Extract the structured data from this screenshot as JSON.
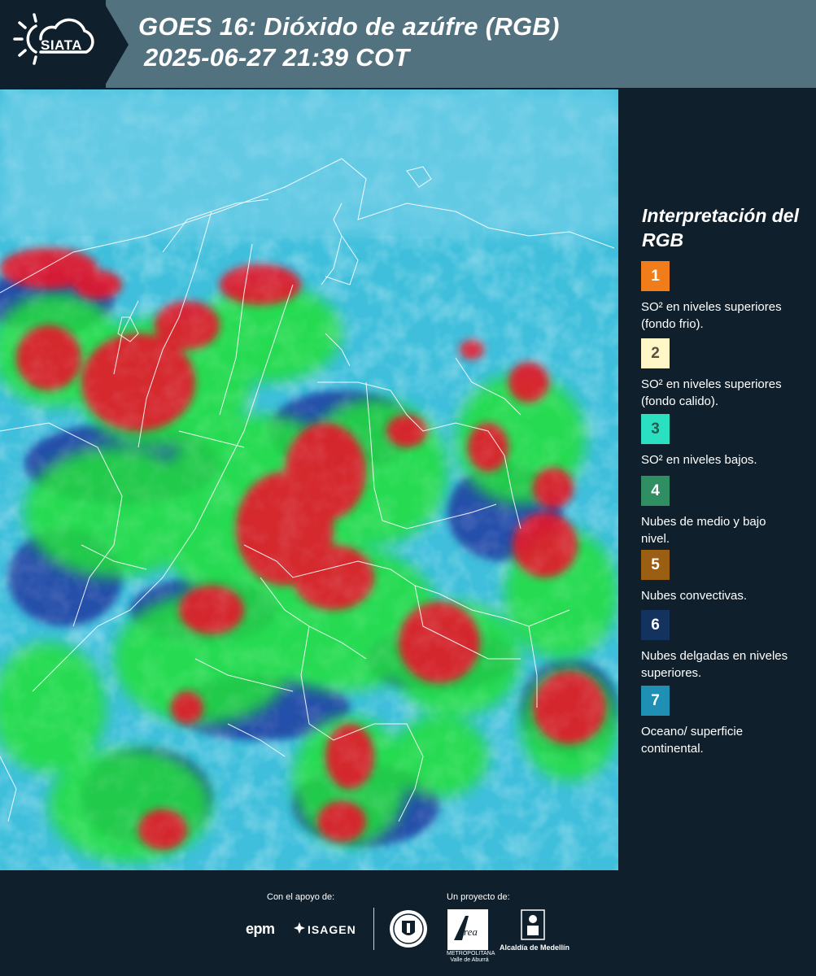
{
  "header": {
    "logo_text": "SIATA",
    "title_line1": "GOES 16: Dióxido de azúfre (RGB)",
    "title_line2": "2025-06-27 21:39 COT"
  },
  "map": {
    "description_icon": "satellite-rgb-composite",
    "colors": {
      "background": "#3bbcd8",
      "red_cloud": "#e8132a",
      "green_cloud": "#22e03a",
      "dark_blue": "#1c2a9a",
      "borders": "#ffffff"
    }
  },
  "legend": {
    "title": "Interpretación del RGB",
    "items": [
      {
        "number": "1",
        "label": "SO² en niveles superiores (fondo frio).",
        "color": "#f07d1a",
        "text_color": "#ffffff"
      },
      {
        "number": "2",
        "label": "SO² en niveles superiores (fondo calido).",
        "color": "#fff7c8",
        "text_color": "#5a5040"
      },
      {
        "number": "3",
        "label": "SO² en niveles bajos.",
        "color": "#2ae0c0",
        "text_color": "#2a5a50"
      },
      {
        "number": "4",
        "label": "Nubes de medio y bajo nivel.",
        "color": "#2f8f63",
        "text_color": "#ffffff"
      },
      {
        "number": "5",
        "label": "Nubes convectivas.",
        "color": "#9a5f12",
        "text_color": "#ffffff"
      },
      {
        "number": "6",
        "label": "Nubes delgadas en niveles superiores.",
        "color": "#13325e",
        "text_color": "#ffffff"
      },
      {
        "number": "7",
        "label": "Oceano/ superficie continental.",
        "color": "#1f8fb3",
        "text_color": "#ffffff"
      }
    ]
  },
  "footer": {
    "support_caption": "Con el apoyo de:",
    "project_caption": "Un proyecto de:",
    "epm": "epm",
    "isagen": "ISAGEN",
    "area_text": "METROPOLITANA Valle de Aburrá",
    "alcaldia": "Alcaldía de Medellín"
  }
}
